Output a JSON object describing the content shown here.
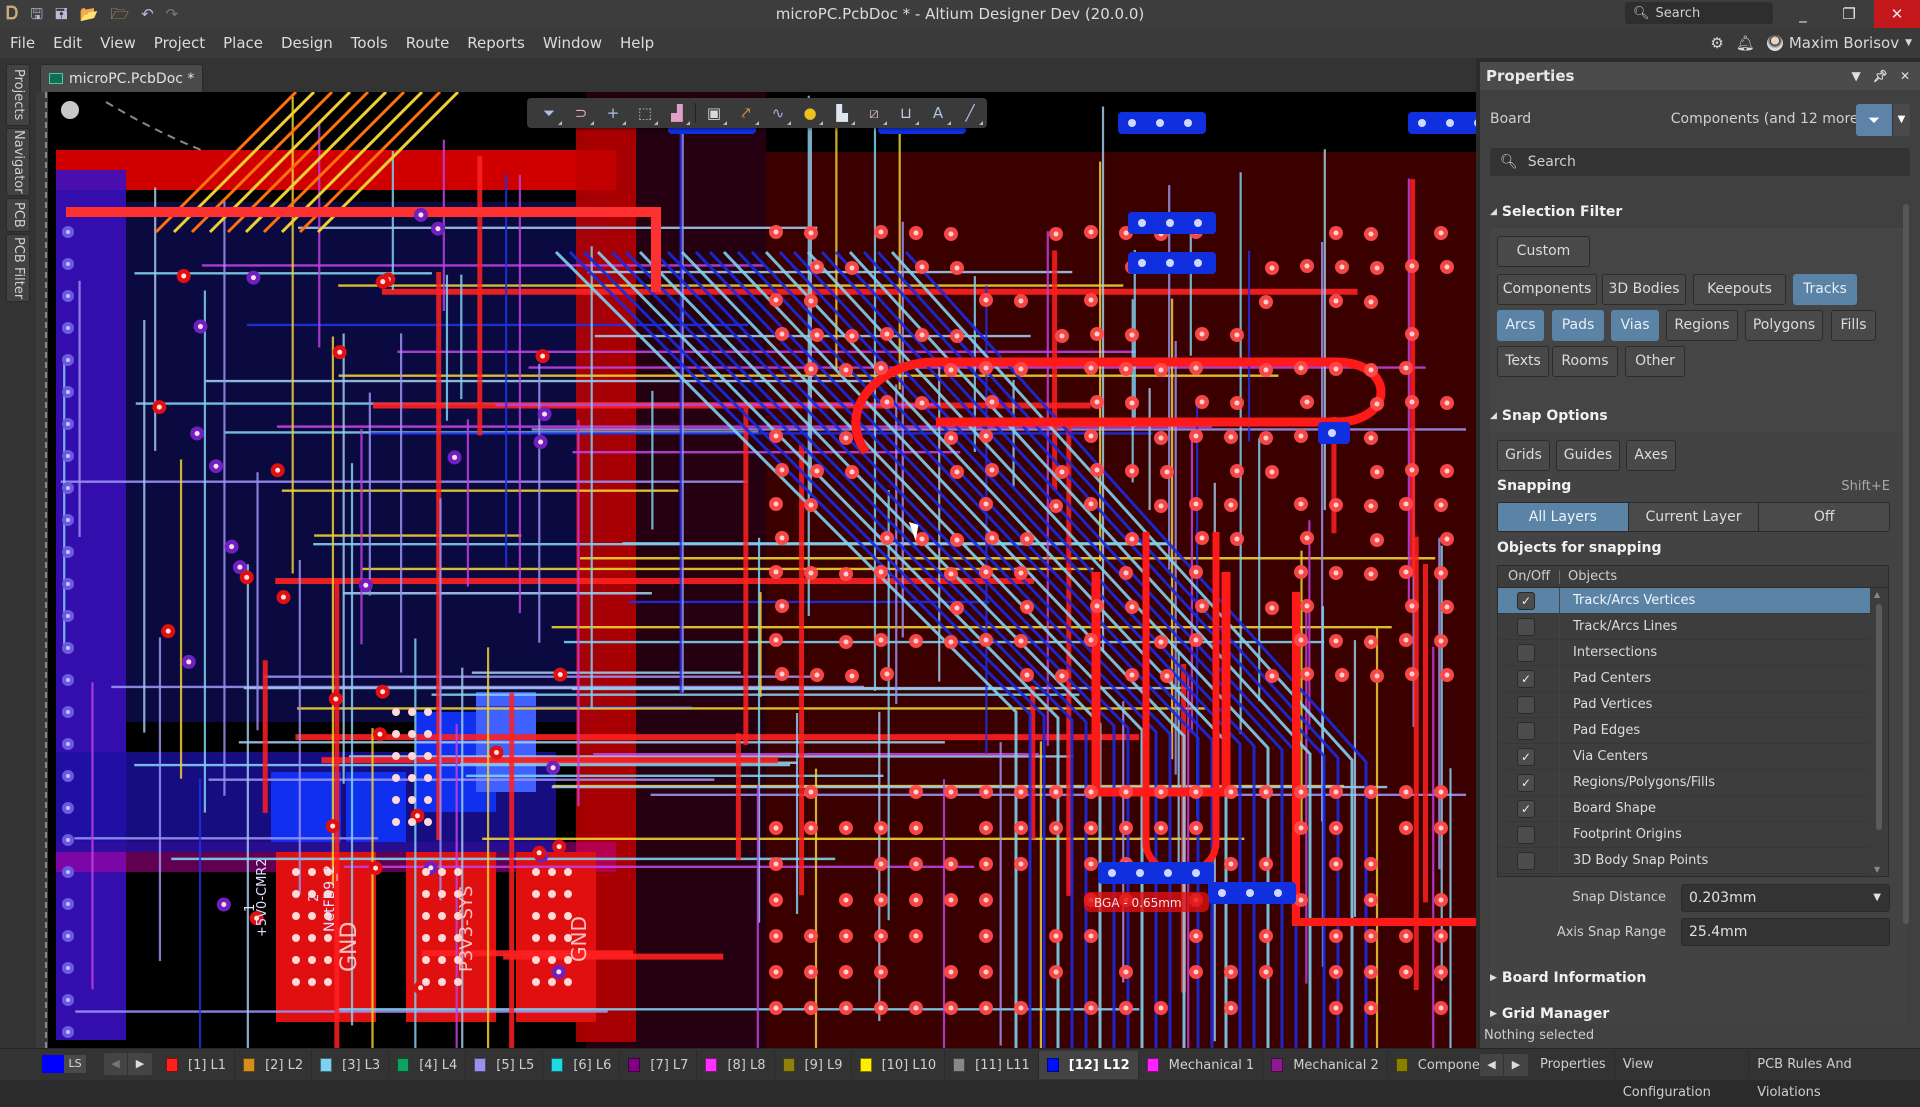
{
  "window": {
    "title": "microPC.PcbDoc * - Altium Designer Dev (20.0.0)",
    "search_placeholder": "Search",
    "quick_access": [
      "app-logo-icon",
      "save-icon",
      "save-all-icon",
      "open-icon",
      "open-project-icon",
      "undo-icon",
      "redo-icon"
    ],
    "controls": {
      "minimize": "_",
      "restore": "❐",
      "close": "✕"
    }
  },
  "menu": {
    "items": [
      "File",
      "Edit",
      "View",
      "Project",
      "Place",
      "Design",
      "Tools",
      "Route",
      "Reports",
      "Window",
      "Help"
    ],
    "user_name": "Maxim Borisov"
  },
  "left_panels": [
    "Projects",
    "Navigator",
    "PCB",
    "PCB Filter"
  ],
  "document_tab": {
    "label": "microPC.PcbDoc *"
  },
  "canvas": {
    "labels": {
      "bga": "BGA - 0.65mm",
      "net1_num": "1",
      "net1": "+5V0-CMR2",
      "net2_num": "2",
      "net2": "NetFB9_2",
      "gnd1": "GND",
      "pwr": "P3V3-SYS",
      "gnd2": "GND"
    },
    "toolbar": [
      {
        "name": "selection-filter-icon",
        "glyph": "⏷"
      },
      {
        "name": "interactive-routing-magnet-icon",
        "glyph": "⊃"
      },
      {
        "name": "crosshair-icon",
        "glyph": "+"
      },
      {
        "name": "select-area-icon",
        "glyph": "⬚"
      },
      {
        "name": "align-icon",
        "glyph": "▟"
      },
      {
        "name": "component-icon",
        "glyph": "▣"
      },
      {
        "name": "route-icon",
        "glyph": "⤤"
      },
      {
        "name": "length-tuning-icon",
        "glyph": "∿"
      },
      {
        "name": "via-icon",
        "glyph": "●"
      },
      {
        "name": "region-icon",
        "glyph": "▙"
      },
      {
        "name": "diff-pair-icon",
        "glyph": "⧄"
      },
      {
        "name": "dimension-icon",
        "glyph": "⊔"
      },
      {
        "name": "text-icon",
        "glyph": "A"
      },
      {
        "name": "line-icon",
        "glyph": "╱"
      }
    ]
  },
  "properties": {
    "title": "Properties",
    "board_label": "Board",
    "filter_summary": "Components (and 12 more)",
    "search_placeholder": "Search",
    "selection_filter": {
      "title": "Selection Filter",
      "buttons": [
        {
          "label": "Custom",
          "on": false
        },
        {
          "label": "Components",
          "on": false
        },
        {
          "label": "3D Bodies",
          "on": false
        },
        {
          "label": "Keepouts",
          "on": false
        },
        {
          "label": "Tracks",
          "on": true
        },
        {
          "label": "Arcs",
          "on": true
        },
        {
          "label": "Pads",
          "on": true
        },
        {
          "label": "Vias",
          "on": true
        },
        {
          "label": "Regions",
          "on": false
        },
        {
          "label": "Polygons",
          "on": false
        },
        {
          "label": "Fills",
          "on": false
        },
        {
          "label": "Texts",
          "on": false
        },
        {
          "label": "Rooms",
          "on": false
        },
        {
          "label": "Other",
          "on": false
        }
      ]
    },
    "snap_options": {
      "title": "Snap Options",
      "guides": [
        {
          "label": "Grids"
        },
        {
          "label": "Guides"
        },
        {
          "label": "Axes"
        }
      ],
      "snapping_label": "Snapping",
      "snapping_shortcut": "Shift+E",
      "snapping_modes": [
        {
          "label": "All Layers",
          "on": true
        },
        {
          "label": "Current Layer",
          "on": false
        },
        {
          "label": "Off",
          "on": false
        }
      ],
      "objects_title": "Objects for snapping",
      "table_headers": {
        "onoff": "On/Off",
        "objects": "Objects"
      },
      "objects": [
        {
          "label": "Track/Arcs Vertices",
          "checked": true,
          "selected": true
        },
        {
          "label": "Track/Arcs Lines",
          "checked": false,
          "selected": false
        },
        {
          "label": "Intersections",
          "checked": false,
          "selected": false
        },
        {
          "label": "Pad Centers",
          "checked": true,
          "selected": false
        },
        {
          "label": "Pad Vertices",
          "checked": false,
          "selected": false
        },
        {
          "label": "Pad Edges",
          "checked": false,
          "selected": false
        },
        {
          "label": "Via Centers",
          "checked": true,
          "selected": false
        },
        {
          "label": "Regions/Polygons/Fills",
          "checked": true,
          "selected": false
        },
        {
          "label": "Board Shape",
          "checked": true,
          "selected": false
        },
        {
          "label": "Footprint Origins",
          "checked": false,
          "selected": false
        },
        {
          "label": "3D Body Snap Points",
          "checked": false,
          "selected": false
        }
      ],
      "snap_distance_label": "Snap Distance",
      "snap_distance": "0.203mm",
      "axis_snap_range_label": "Axis Snap Range",
      "axis_snap_range": "25.4mm"
    },
    "collapsed_sections": [
      "Board Information",
      "Grid Manager"
    ],
    "status": "Nothing selected"
  },
  "layer_tabs": {
    "current": {
      "color": "#0000ff",
      "label": "LS"
    },
    "tabs": [
      {
        "label": "[1] L1",
        "color": "#ff2020",
        "active": false
      },
      {
        "label": "[2] L2",
        "color": "#d4901c",
        "active": false
      },
      {
        "label": "[3] L3",
        "color": "#80d0f0",
        "active": false
      },
      {
        "label": "[4] L4",
        "color": "#10a060",
        "active": false
      },
      {
        "label": "[5] L5",
        "color": "#9a90f0",
        "active": false
      },
      {
        "label": "[6] L6",
        "color": "#20d8e0",
        "active": false
      },
      {
        "label": "[7] L7",
        "color": "#800080",
        "active": false
      },
      {
        "label": "[8] L8",
        "color": "#ff30ff",
        "active": false
      },
      {
        "label": "[9] L9",
        "color": "#908010",
        "active": false
      },
      {
        "label": "[10] L10",
        "color": "#ffee00",
        "active": false
      },
      {
        "label": "[11] L11",
        "color": "#888888",
        "active": false
      },
      {
        "label": "[12] L12",
        "color": "#0010ff",
        "active": true
      },
      {
        "label": "Mechanical 1",
        "color": "#ff20ff",
        "active": false
      },
      {
        "label": "Mechanical 2",
        "color": "#901890",
        "active": false
      },
      {
        "label": "Component Outli",
        "color": "#8a7f00",
        "active": false
      }
    ]
  },
  "panel_tabs": [
    "Properties",
    "View Configuration",
    "PCB Rules And Violations"
  ]
}
